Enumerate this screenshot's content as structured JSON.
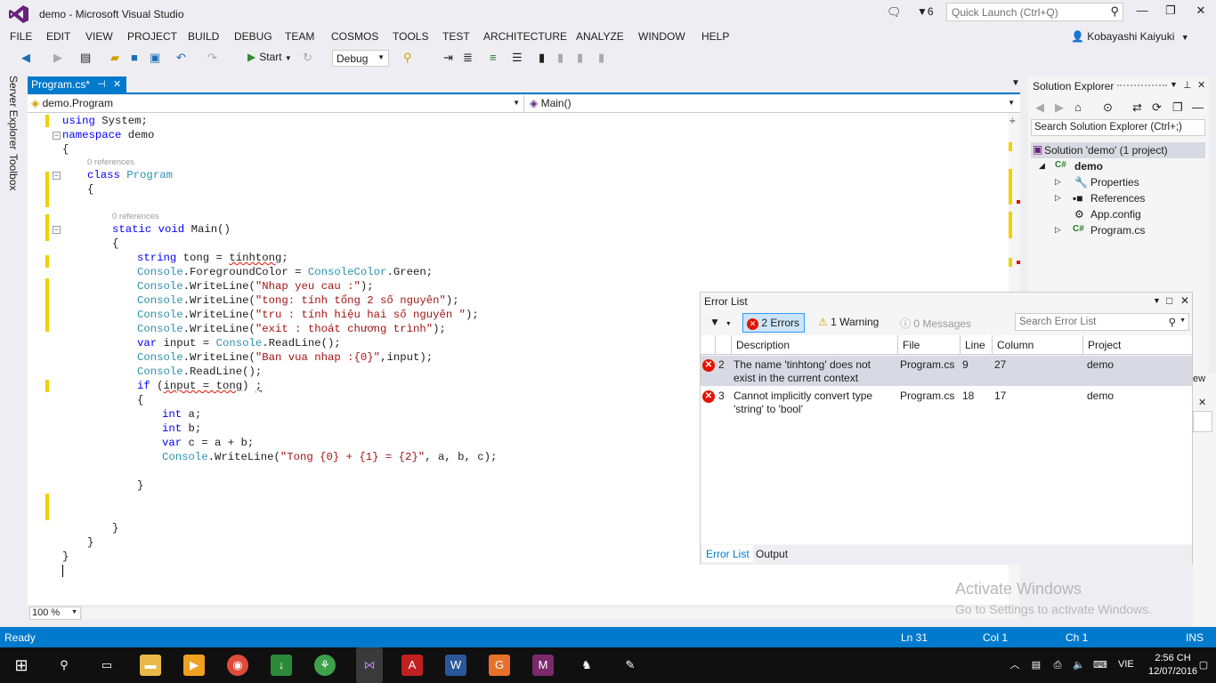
{
  "window": {
    "title": "demo - Microsoft Visual Studio",
    "notifications_count": "6",
    "quick_launch_placeholder": "Quick Launch (Ctrl+Q)",
    "user": "Kobayashi Kaiyuki"
  },
  "menu": [
    "FILE",
    "EDIT",
    "VIEW",
    "PROJECT",
    "BUILD",
    "DEBUG",
    "TEAM",
    "COSMOS",
    "TOOLS",
    "TEST",
    "ARCHITECTURE",
    "ANALYZE",
    "WINDOW",
    "HELP"
  ],
  "toolbar": {
    "start_label": "Start",
    "config": "Debug"
  },
  "left_sidebar": {
    "server_explorer": "Server Explorer",
    "toolbox": "Toolbox"
  },
  "document_tab": {
    "label": "Program.cs*"
  },
  "nav": {
    "type": "demo.Program",
    "member": "Main()"
  },
  "code": {
    "references_label": "0 references",
    "lines": [
      "using System;",
      "namespace demo",
      "{",
      "class Program",
      "{",
      "static void Main()",
      "{",
      "string tong = tinhtong;",
      "Console.ForegroundColor = ConsoleColor.Green;",
      "Console.WriteLine(\"Nhap yeu cau :\");",
      "Console.WriteLine(\"tong: tính tổng 2 số nguyên\");",
      "Console.WriteLine(\"tru : tính hiệu hai số nguyên \");",
      "Console.WriteLine(\"exit : thoát chương trình\");",
      "var input = Console.ReadLine();",
      "Console.WriteLine(\"Ban vua nhap :{0}\",input);",
      "Console.ReadLine();",
      "if (input = tong) ;",
      "{",
      "int a;",
      "int b;",
      "var c = a + b;",
      "Console.WriteLine(\"Tong {0} + {1} = {2}\", a, b, c);",
      "}",
      "}",
      "}",
      "}"
    ]
  },
  "zoom": "100 %",
  "solution_explorer": {
    "title": "Solution Explorer",
    "search_placeholder": "Search Solution Explorer (Ctrl+;)",
    "root": "Solution 'demo' (1 project)",
    "project": "demo",
    "items": [
      "Properties",
      "References",
      "App.config",
      "Program.cs"
    ]
  },
  "error_list": {
    "title": "Error List",
    "errors_label": "2 Errors",
    "warnings_label": "1 Warning",
    "messages_label": "0 Messages",
    "search_placeholder": "Search Error List",
    "columns": [
      "Description",
      "File",
      "Line",
      "Column",
      "Project"
    ],
    "rows": [
      {
        "num": "2",
        "description_1": "The name 'tinhtong' does not",
        "description_2": "exist in the current context",
        "file": "Program.cs",
        "line": "9",
        "column": "27",
        "project": "demo"
      },
      {
        "num": "3",
        "description_1": "Cannot implicitly convert type",
        "description_2": "'string' to 'bool'",
        "file": "Program.cs",
        "line": "18",
        "column": "17",
        "project": "demo"
      }
    ],
    "tabs": [
      "Error List",
      "Output"
    ]
  },
  "panel2_partial_text": "ew",
  "activate": {
    "line1": "Activate Windows",
    "line2": "Go to Settings to activate Windows."
  },
  "status": {
    "ready": "Ready",
    "ln": "Ln 31",
    "col": "Col 1",
    "ch": "Ch 1",
    "ins": "INS"
  },
  "taskbar": {
    "lang": "VIE",
    "time": "2:56 CH",
    "date": "12/07/2016"
  }
}
